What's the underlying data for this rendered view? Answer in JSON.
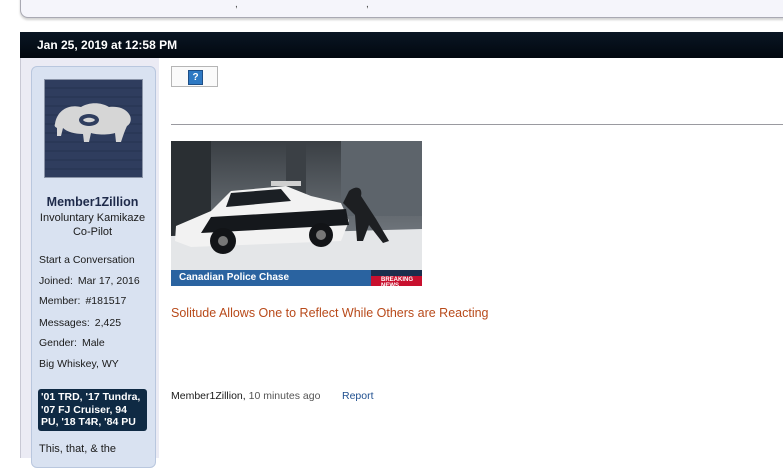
{
  "previous_post": {
    "fragments": [
      ",",
      ","
    ]
  },
  "post": {
    "timestamp": "Jan 25, 2019 at 12:58 PM",
    "author": {
      "username": "Member1Zillion",
      "title": "Involuntary Kamikaze Co-Pilot",
      "start_conversation": "Start a Conversation",
      "stats": [
        {
          "label": "Joined:",
          "value": "Mar 17, 2016"
        },
        {
          "label": "Member:",
          "value": "#181517"
        },
        {
          "label": "Messages:",
          "value": "2,425"
        },
        {
          "label": "Gender:",
          "value": "Male"
        },
        {
          "label": "",
          "value": "Big Whiskey, WY"
        }
      ],
      "garage_lines": [
        "'01 TRD, '17 Tundra,",
        "'07 FJ Cruiser, 94",
        "PU, '18 T4R, '84 PU"
      ],
      "signature_fragment": "This, that, & the"
    },
    "broken_image_glyph": "?",
    "gif": {
      "caption": "Canadian Police Chase",
      "banner": "BREAKING NEWS"
    },
    "signature_quote": "Solitude Allows One to Reflect While Others are Reacting",
    "footer": {
      "author": "Member1Zillion",
      "time": "10 minutes ago",
      "report_label": "Report"
    }
  },
  "colors": {
    "header": "#02080f",
    "quote": "#b84a1a",
    "link": "#1f4f8f",
    "panel": "#d9e2f1",
    "garage_badge": "#0f2a44"
  },
  "icons": {
    "broken_image": "broken-image-icon",
    "avatar": "wyoming-flag-bison-avatar"
  }
}
